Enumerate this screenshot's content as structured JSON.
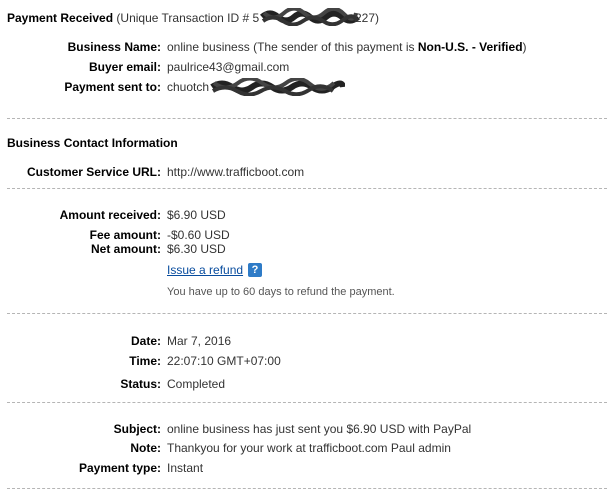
{
  "header": {
    "title": "Payment Received",
    "txn_prefix": "(Unique Transaction ID #",
    "txn_visible_start": "5",
    "txn_visible_end": "227)"
  },
  "payment": {
    "business_name_label": "Business Name:",
    "business_name_value": "online business",
    "sender_note_prefix": "(The sender of this payment is",
    "sender_note_status": "Non-U.S. - Verified",
    "sender_note_suffix": ")",
    "buyer_email_label": "Buyer email:",
    "buyer_email_value": "paulrice43@gmail.com",
    "sent_to_label": "Payment sent to:",
    "sent_to_value_visible": "chuotch"
  },
  "contact": {
    "section_title": "Business Contact Information",
    "url_label": "Customer Service URL:",
    "url_value": "http://www.trafficboot.com"
  },
  "amounts": {
    "received_label": "Amount received:",
    "received_value": "$6.90 USD",
    "fee_label": "Fee amount:",
    "fee_value": "-$0.60 USD",
    "net_label": "Net amount:",
    "net_value": "$6.30 USD",
    "refund_link": "Issue a refund",
    "refund_help": "?",
    "refund_note": "You have up to 60 days to refund the payment."
  },
  "details": {
    "date_label": "Date:",
    "date_value": "Mar 7, 2016",
    "time_label": "Time:",
    "time_value": "22:07:10 GMT+07:00",
    "status_label": "Status:",
    "status_value": "Completed"
  },
  "message": {
    "subject_label": "Subject:",
    "subject_value": "online business has just sent you $6.90 USD with PayPal",
    "note_label": "Note:",
    "note_value": "Thankyou for your work at trafficboot.com Paul admin",
    "type_label": "Payment type:",
    "type_value": "Instant"
  },
  "colors": {
    "link": "#084c9e",
    "help_icon": "#2e7bc7",
    "rule": "#b5b5b5"
  }
}
